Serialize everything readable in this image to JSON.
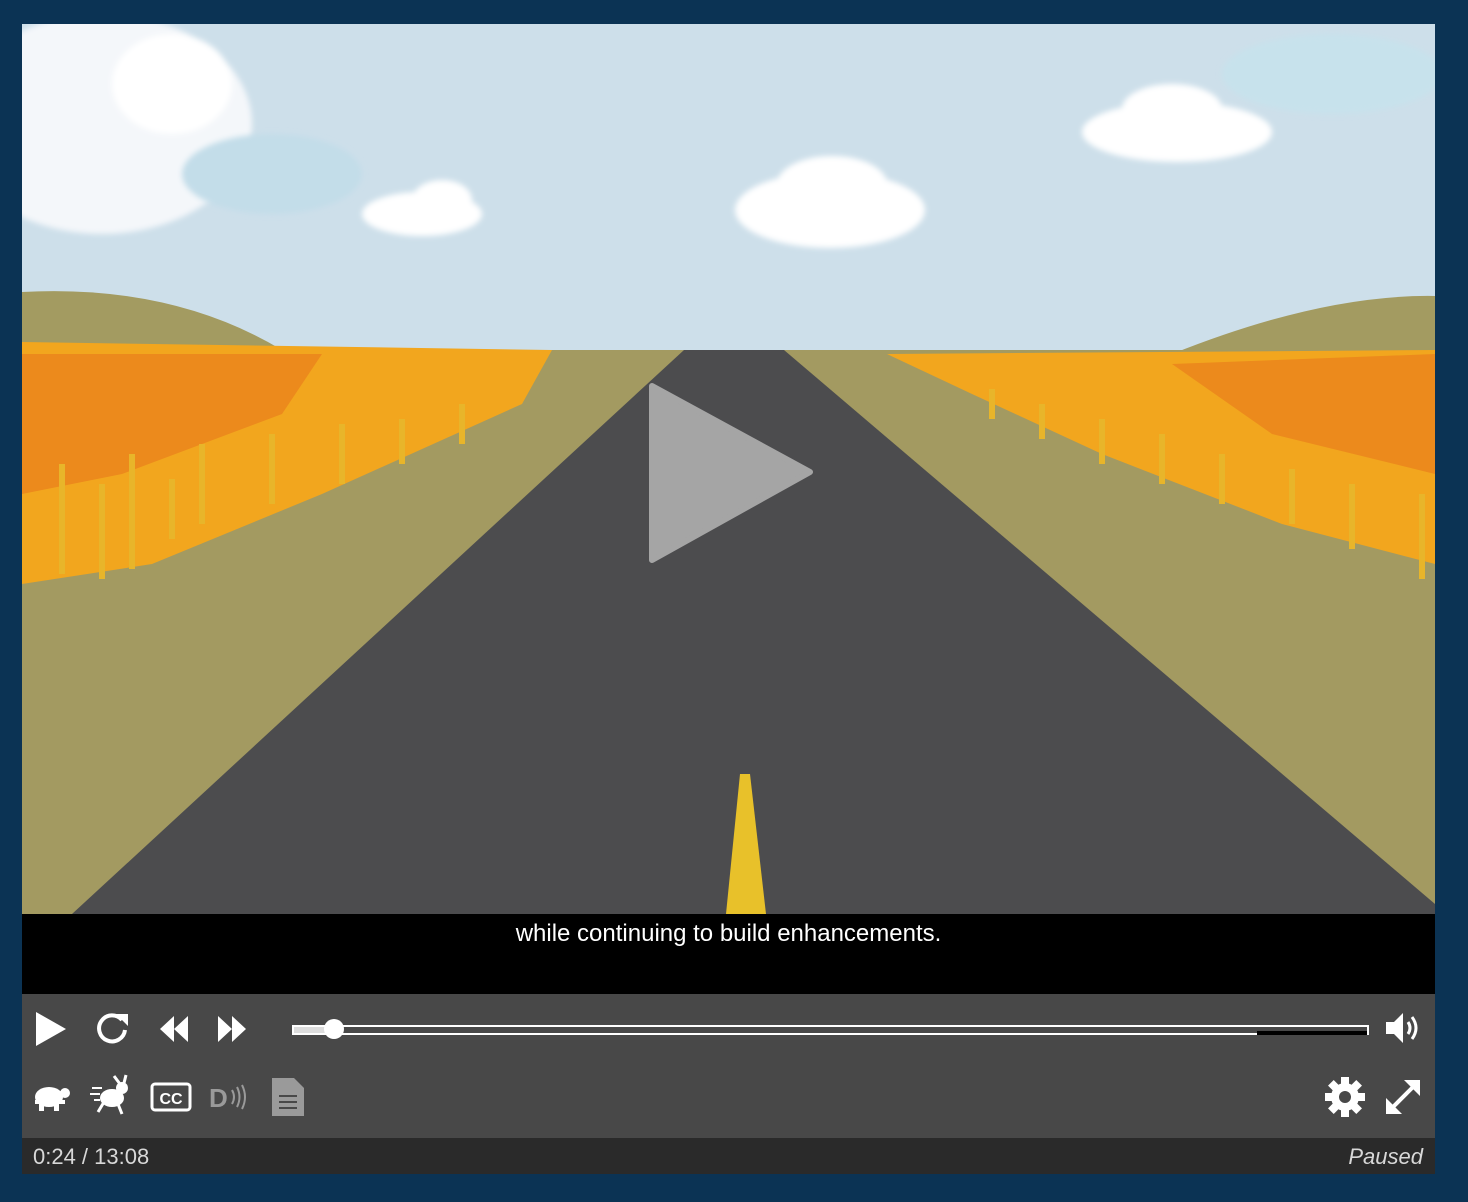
{
  "player": {
    "caption_text": "while continuing to build enhancements.",
    "elapsed": "0:24",
    "separator": "/",
    "duration": "13:08",
    "time_display": "0:24 / 13:08",
    "status": "Paused",
    "progress_fraction": 0.03
  },
  "controls": {
    "play": "play-icon",
    "restart": "restart-icon",
    "rewind": "rewind-icon",
    "forward": "fast-forward-icon",
    "volume": "volume-icon",
    "slower": "turtle-icon",
    "faster": "rabbit-icon",
    "captions": "cc-icon",
    "description": "audio-description-icon",
    "transcript": "transcript-icon",
    "settings": "gear-icon",
    "fullscreen": "fullscreen-icon"
  },
  "colors": {
    "frame": "#0b3354",
    "controls_bg": "#484848",
    "status_bg": "#2a2a2a"
  }
}
